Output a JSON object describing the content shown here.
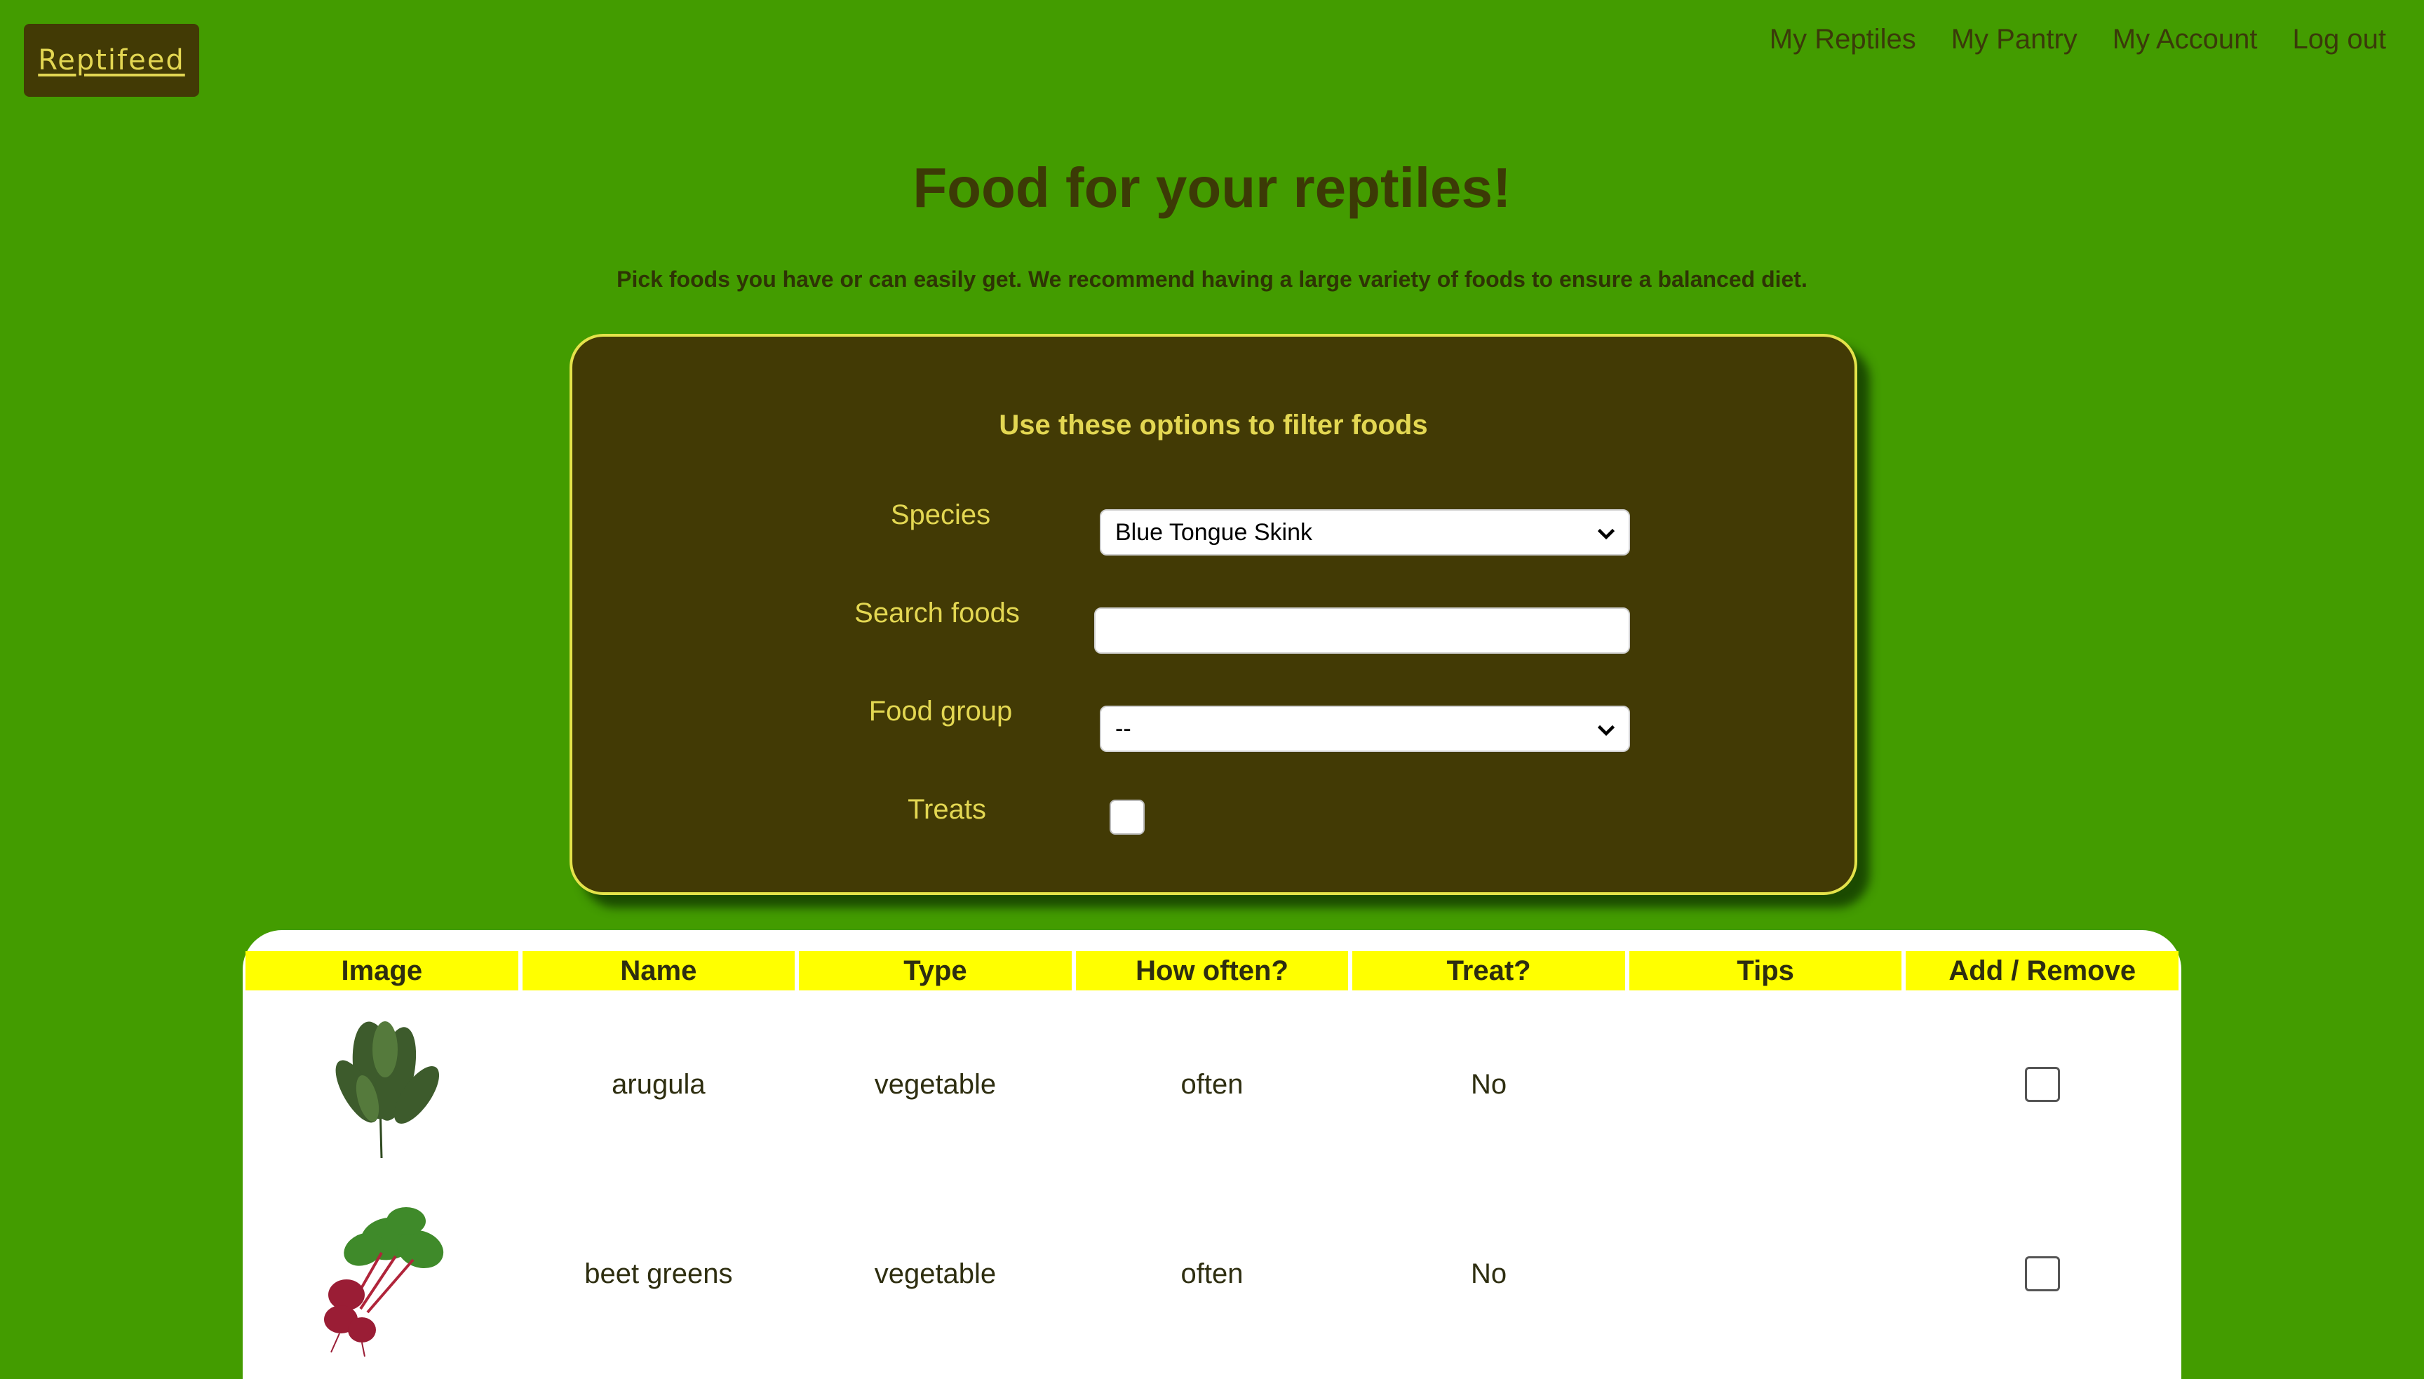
{
  "brand": {
    "name": "Reptifeed"
  },
  "nav": {
    "items": [
      "My Reptiles",
      "My Pantry",
      "My Account",
      "Log out"
    ]
  },
  "page": {
    "title": "Food for your reptiles!",
    "subtitle": "Pick foods you have or can easily get. We recommend having a large variety of foods to ensure a balanced diet."
  },
  "filters": {
    "heading": "Use these options to filter foods",
    "species_label": "Species",
    "species_value": "Blue Tongue Skink",
    "search_label": "Search foods",
    "search_value": "",
    "group_label": "Food group",
    "group_value": "--",
    "treats_label": "Treats",
    "treats_checked": false
  },
  "table": {
    "headers": [
      "Image",
      "Name",
      "Type",
      "How often?",
      "Treat?",
      "Tips",
      "Add / Remove"
    ],
    "rows": [
      {
        "image": "arugula-image",
        "name": "arugula",
        "type": "vegetable",
        "how_often": "often",
        "treat": "No",
        "tips": "",
        "added": false
      },
      {
        "image": "beet-greens-image",
        "name": "beet greens",
        "type": "vegetable",
        "how_often": "often",
        "treat": "No",
        "tips": "",
        "added": false
      }
    ]
  },
  "colors": {
    "background": "#439c00",
    "panel": "#423a05",
    "panel_border": "#e4e34a",
    "panel_text": "#e3d752",
    "table_header": "#ffff00"
  }
}
